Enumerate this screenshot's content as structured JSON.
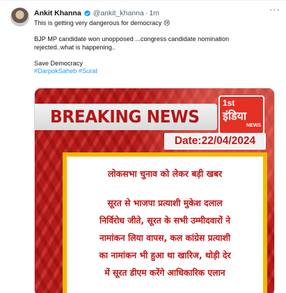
{
  "tweet": {
    "author_name": "Ankit Khanna",
    "handle": "@ankit_khanna",
    "separator": "·",
    "time": "1m",
    "more_label": "···",
    "line1": "This is getting very dangerous for democracy 😢",
    "line2": "BJP MP candidate won unopposed ...congress candidate nomination",
    "line3": "rejected..what is happening..",
    "line4": "Save Democracy",
    "hashtag1": "#DarpokSaheb",
    "hashtag2": "#Surat"
  },
  "media": {
    "headline": "BREAKING NEWS",
    "logo_number": "1st",
    "logo_name": "इंडिया",
    "logo_sub": "NEWS",
    "date": "Date:22/04/2024",
    "panel_heading": "लोकसभा चुनाव को लेकर बड़ी खबर",
    "panel_lines": [
      "सूरत से भाजपा प्रत्याशी मुकेश दलाल",
      "निर्विरोध जीते, सूरत के सभी उम्मीदवारों ने",
      "नामांकन लिया वापस, कल कांग्रेस प्रत्याशी",
      "का नामांकन भी हुआ था खारिज, थोड़ी देर",
      "में सूरत डीएम करेंगे आधिकारिक एलान"
    ]
  },
  "colors": {
    "link": "#1d9bf0",
    "verified": "#1d9bf0",
    "breaking_red": "#b41515",
    "panel_border": "#f5b800"
  }
}
